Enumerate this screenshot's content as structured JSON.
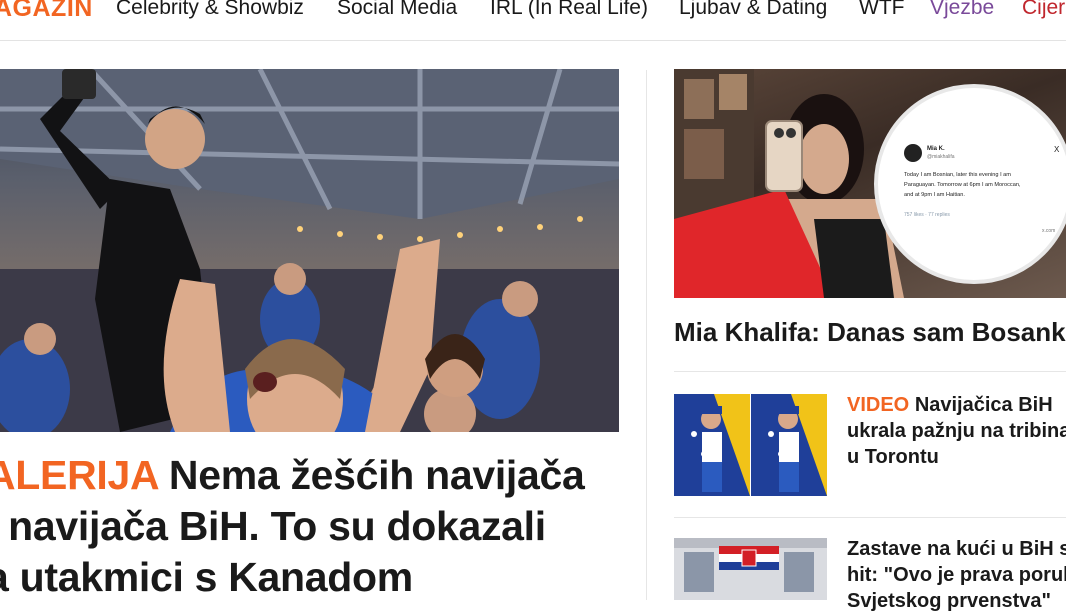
{
  "nav": {
    "logo": "AGAZIN",
    "items": [
      {
        "label": "Celebrity & Showbiz",
        "color": "#1a1a1a"
      },
      {
        "label": "Social Media",
        "color": "#1a1a1a"
      },
      {
        "label": "IRL (In Real Life)",
        "color": "#1a1a1a"
      },
      {
        "label": "Ljubav & Dating",
        "color": "#1a1a1a"
      },
      {
        "label": "WTF",
        "color": "#1a1a1a"
      },
      {
        "label": "Vjezbe",
        "color": "#7a4a9a"
      },
      {
        "label": "Cijer",
        "color": "#c0262d"
      }
    ]
  },
  "hero": {
    "tag": "ALERIJA",
    "lines": [
      "Nema žešćih navijača",
      "l navijača BiH. To su dokazali",
      "a utakmici s Kanadom"
    ]
  },
  "side_main": {
    "title": "Mia Khalifa: Danas sam Bosanka",
    "tweet": {
      "name": "Mia K.",
      "handle": "@miakhalifa",
      "close": "X",
      "text": "Today I am Bosnian, later this evening I am Paraguayan. Tomorrow at 6pm I am Moroccan, and at 9pm I am Haitian.",
      "stats": "757 likes · 77 replies",
      "footer": "x.com"
    }
  },
  "small_articles": [
    {
      "tag": "VIDEO",
      "lines": [
        "Navijačica BiH",
        "ukrala pažnju na tribina",
        "u Torontu"
      ]
    },
    {
      "tag": "",
      "lines": [
        "Zastave na kući u BiH s",
        "hit: \"Ovo je prava poruk",
        "Svjetskog prvenstva\""
      ]
    }
  ],
  "colors": {
    "accent": "#f26522",
    "text": "#1a1a1a",
    "divider": "#e6e6e6"
  }
}
